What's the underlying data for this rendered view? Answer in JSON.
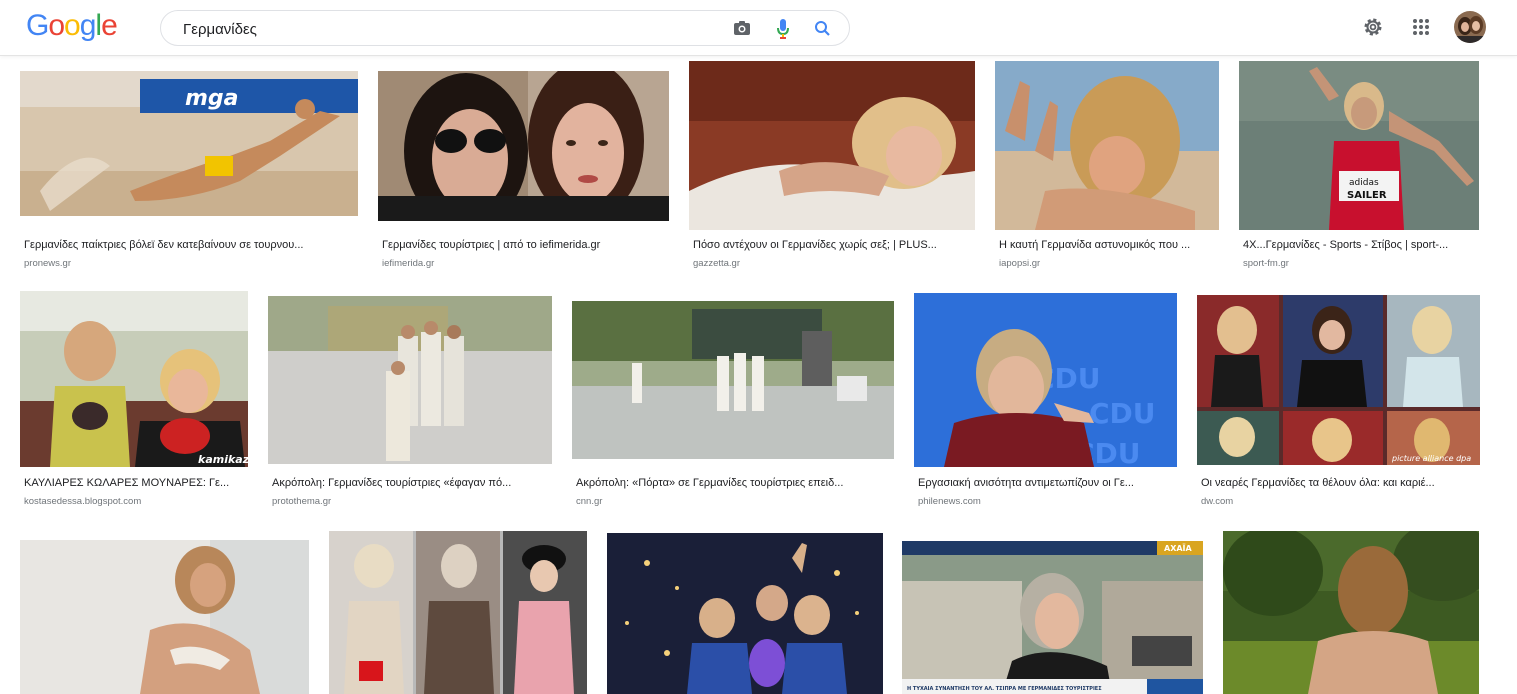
{
  "search": {
    "query": "Γερμανίδες"
  },
  "logo": {
    "letters": [
      "G",
      "o",
      "o",
      "g",
      "l",
      "e"
    ],
    "colors": [
      "#4285f4",
      "#ea4335",
      "#fbbc05",
      "#4285f4",
      "#34a853",
      "#ea4335"
    ]
  },
  "icons": {
    "camera": "camera-icon",
    "mic": "microphone-icon",
    "search": "search-icon",
    "settings": "gear-icon",
    "apps": "apps-grid-icon",
    "avatar": "avatar"
  },
  "results": [
    {
      "caption": "Γερμανίδες παίκτριες βόλεϊ δεν κατεβαίνουν σε τουρνου...",
      "source": "pronews.gr"
    },
    {
      "caption": "Γερμανίδες τουρίστριες | από το iefimerida.gr",
      "source": "iefimerida.gr"
    },
    {
      "caption": "Πόσο αντέχουν οι Γερμανίδες χωρίς σεξ; | PLUS...",
      "source": "gazzetta.gr"
    },
    {
      "caption": "Η καυτή Γερμανίδα αστυνομικός που ...",
      "source": "iapopsi.gr"
    },
    {
      "caption": "4Χ...Γερμανίδες - Sports - Στίβος | sport-...",
      "source": "sport-fm.gr"
    },
    {
      "caption": "ΚΑΥΛΙΑΡΕΣ ΚΩΛΑΡΕΣ ΜΟΥΝΑΡΕΣ: Γε...",
      "source": "kostasedessa.blogspot.com"
    },
    {
      "caption": "Ακρόπολη: Γερμανίδες τουρίστριες «έφαγαν πό...",
      "source": "protothema.gr"
    },
    {
      "caption": "Ακρόπολη: «Πόρτα» σε Γερμανίδες τουρίστριες επειδ...",
      "source": "cnn.gr"
    },
    {
      "caption": "Εργασιακή ανισότητα αντιμετωπίζουν οι Γε...",
      "source": "philenews.com"
    },
    {
      "caption": "Οι νεαρές Γερμανίδες τα θέλουν όλα: και καριέ...",
      "source": "dw.com"
    },
    {
      "caption": "",
      "source": ""
    },
    {
      "caption": "",
      "source": ""
    },
    {
      "caption": "",
      "source": ""
    },
    {
      "caption": "",
      "source": ""
    },
    {
      "caption": "",
      "source": ""
    }
  ],
  "overlays": {
    "mga": "mga",
    "kamikazi": "kamikazi",
    "cdu": "CDU",
    "adidas": "adidas",
    "sailer": "SAILER",
    "picture_alliance": "picture alliance dpa",
    "achaia": "ΑΧΑΪΑ",
    "tsipras_banner": "Η ΤΥΧΑΙΑ ΣΥΝΑΝΤΗΣΗ ΤΟΥ ΑΛ. ΤΣΙΠΡΑ ΜΕ ΓΕΡΜΑΝΙΔΕΣ ΤΟΥΡΙΣΤΡΙΕΣ"
  }
}
